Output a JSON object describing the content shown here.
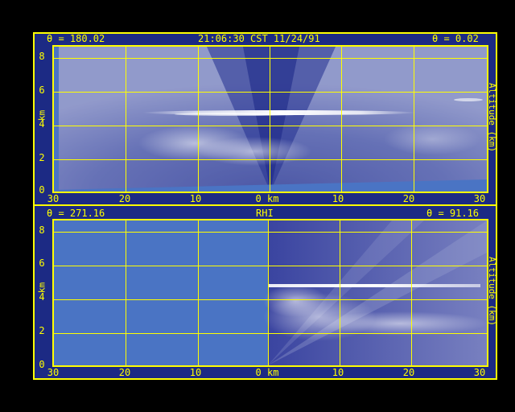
{
  "top_panel": {
    "left_angle": "θ = 180.02",
    "center_title": "21:06:30 CST 11/24/91",
    "right_angle": "θ = 0.02",
    "y_ticks": [
      "0",
      "2",
      "4",
      "6",
      "8"
    ],
    "y_label_left": "km",
    "y_label_right": "Altitude (km)",
    "x_ticks": [
      "30",
      "20",
      "10",
      "0 km",
      "10",
      "20",
      "30"
    ]
  },
  "bottom_panel": {
    "left_angle": "θ = 271.16",
    "center_title": "RHI",
    "right_angle": "θ = 91.16",
    "y_ticks": [
      "0",
      "2",
      "4",
      "6",
      "8"
    ],
    "y_label_left": "km",
    "y_label_right": "Altitude (km)",
    "x_ticks": [
      "30",
      "20",
      "10",
      "0 km",
      "10",
      "20",
      "30"
    ]
  },
  "colors": {
    "frame_bg": "#1c2a84",
    "axes": "#ffff00",
    "no_data": "#4a74c4",
    "echo_strong": "#ffffff"
  }
}
